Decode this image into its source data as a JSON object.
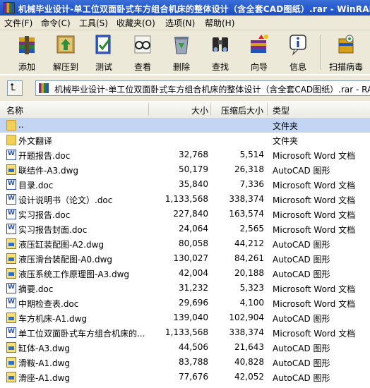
{
  "window": {
    "title": "机械毕业设计-单工位双面卧式车方组合机床的整体设计（含全套CAD图纸）.rar - WinRAR"
  },
  "menu": [
    "文件(F)",
    "命令(C)",
    "工具(S)",
    "收藏夹(O)",
    "选项(N)",
    "帮助(H)"
  ],
  "toolbar": {
    "add": "添加",
    "extract": "解压到",
    "test": "测试",
    "view": "查看",
    "delete": "删除",
    "find": "查找",
    "wizard": "向导",
    "info": "信息",
    "virus": "扫描病毒"
  },
  "address": {
    "path": "机械毕业设计-单工位双面卧式车方组合机床的整体设计（含全套CAD图纸）.rar - RAR"
  },
  "columns": {
    "name": "名称",
    "size": "大小",
    "packed": "压缩后大小",
    "type": "类型"
  },
  "files": [
    {
      "name": "..",
      "size": "",
      "packed": "",
      "type": "文件夹",
      "icon": "folder"
    },
    {
      "name": "外文翻译",
      "size": "",
      "packed": "",
      "type": "文件夹",
      "icon": "folder"
    },
    {
      "name": "开题报告.doc",
      "size": "32,768",
      "packed": "5,514",
      "type": "Microsoft Word 文档",
      "icon": "doc"
    },
    {
      "name": "联结件-A3.dwg",
      "size": "50,179",
      "packed": "26,318",
      "type": "AutoCAD 图形",
      "icon": "dwg"
    },
    {
      "name": "目录.doc",
      "size": "35,840",
      "packed": "7,336",
      "type": "Microsoft Word 文档",
      "icon": "doc"
    },
    {
      "name": "设计说明书（论文）.doc",
      "size": "1,133,568",
      "packed": "338,374",
      "type": "Microsoft Word 文档",
      "icon": "doc"
    },
    {
      "name": "实习报告.doc",
      "size": "227,840",
      "packed": "163,574",
      "type": "Microsoft Word 文档",
      "icon": "doc"
    },
    {
      "name": "实习报告封面.doc",
      "size": "24,064",
      "packed": "2,565",
      "type": "Microsoft Word 文档",
      "icon": "doc"
    },
    {
      "name": "液压缸装配图-A2.dwg",
      "size": "80,058",
      "packed": "44,212",
      "type": "AutoCAD 图形",
      "icon": "dwg"
    },
    {
      "name": "液压滑台装配图-A0.dwg",
      "size": "130,027",
      "packed": "84,261",
      "type": "AutoCAD 图形",
      "icon": "dwg"
    },
    {
      "name": "液压系统工作原理图-A3.dwg",
      "size": "42,004",
      "packed": "20,188",
      "type": "AutoCAD 图形",
      "icon": "dwg"
    },
    {
      "name": "摘要.doc",
      "size": "31,232",
      "packed": "5,323",
      "type": "Microsoft Word 文档",
      "icon": "doc"
    },
    {
      "name": "中期检查表.doc",
      "size": "29,696",
      "packed": "4,100",
      "type": "Microsoft Word 文档",
      "icon": "doc"
    },
    {
      "name": "车方机床-A1.dwg",
      "size": "139,040",
      "packed": "102,904",
      "type": "AutoCAD 图形",
      "icon": "dwg"
    },
    {
      "name": "单工位双面卧式车方组合机床的...",
      "size": "1,133,568",
      "packed": "338,374",
      "type": "Microsoft Word 文档",
      "icon": "doc"
    },
    {
      "name": "缸体-A3.dwg",
      "size": "44,506",
      "packed": "21,643",
      "type": "AutoCAD 图形",
      "icon": "dwg"
    },
    {
      "name": "滑鞍-A1.dwg",
      "size": "83,788",
      "packed": "40,828",
      "type": "AutoCAD 图形",
      "icon": "dwg"
    },
    {
      "name": "滑座-A1.dwg",
      "size": "77,676",
      "packed": "42,052",
      "type": "AutoCAD 图形",
      "icon": "dwg"
    }
  ]
}
